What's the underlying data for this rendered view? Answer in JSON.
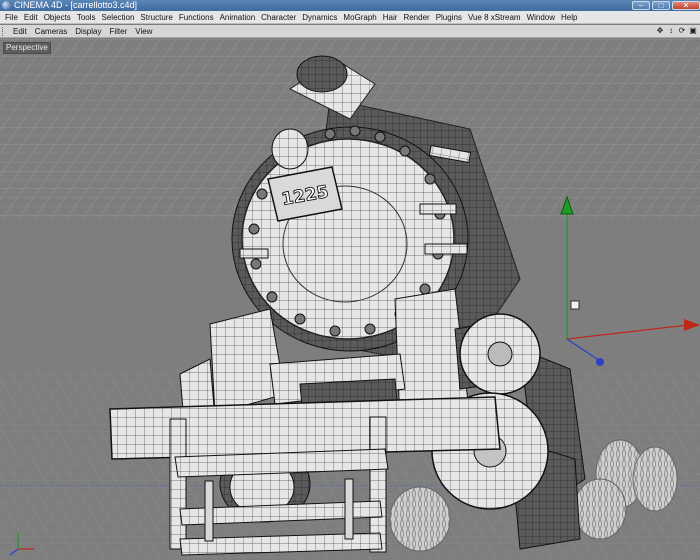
{
  "window": {
    "title": "CINEMA 4D - [carrellotto3.c4d]",
    "buttons": {
      "minimize": "–",
      "maximize": "□",
      "close": "✕"
    }
  },
  "menubar": {
    "items": [
      "File",
      "Edit",
      "Objects",
      "Tools",
      "Selection",
      "Structure",
      "Functions",
      "Animation",
      "Character",
      "Dynamics",
      "MoGraph",
      "Hair",
      "Render",
      "Plugins",
      "Vue 8 xStream",
      "Window",
      "Help"
    ]
  },
  "viewbar": {
    "items": [
      "Edit",
      "Cameras",
      "Display",
      "Filter",
      "View"
    ],
    "icons": [
      {
        "name": "move-view-icon",
        "glyph": "✥"
      },
      {
        "name": "zoom-view-icon",
        "glyph": "↕"
      },
      {
        "name": "rotate-view-icon",
        "glyph": "⟳"
      },
      {
        "name": "toggle-layout-icon",
        "glyph": "▣"
      }
    ]
  },
  "viewport": {
    "label": "Perspective",
    "plate_number": "1225",
    "colors": {
      "background": "#7e7e7e",
      "grid": "#9c9c9c",
      "model_fill": "#e4e4e4",
      "model_shade": "#3e3e3e",
      "axis_x": "#c0271b",
      "axis_y": "#1c9b25",
      "axis_z": "#2b3fc7"
    }
  }
}
